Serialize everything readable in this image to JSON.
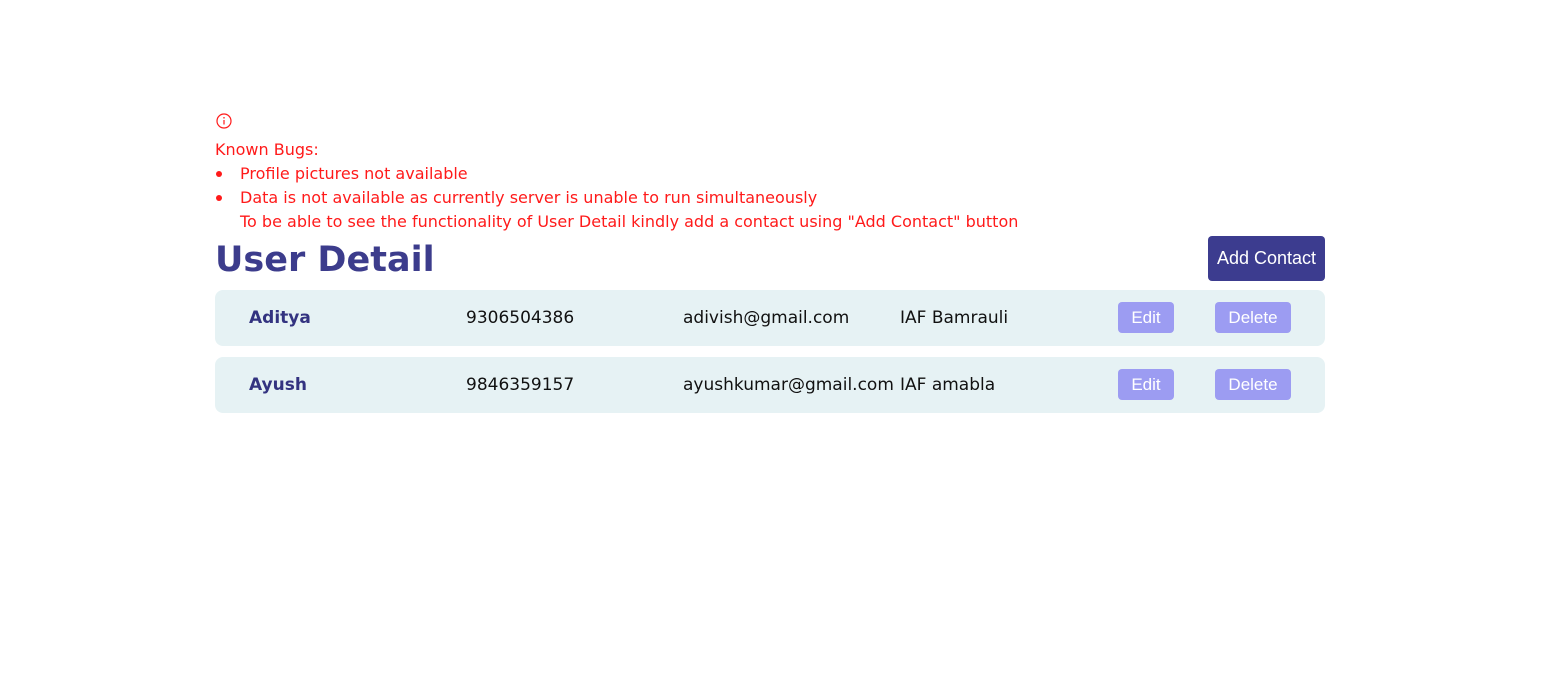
{
  "notice": {
    "icon": "info-circle-icon",
    "title": "Known Bugs:",
    "items": [
      "Profile pictures not available",
      "Data is not available as currently server is unable to run simultaneously"
    ],
    "note": "To be able to see the functionality of User Detail kindly add a contact using \"Add Contact\" button",
    "color": "#ff1a1a"
  },
  "header": {
    "title": "User Detail",
    "add_label": "Add Contact"
  },
  "contacts": [
    {
      "name": "Aditya",
      "phone": "9306504386",
      "email": "adivish@gmail.com",
      "address": "IAF Bamrauli",
      "edit_label": "Edit",
      "delete_label": "Delete"
    },
    {
      "name": "Ayush",
      "phone": "9846359157",
      "email": "ayushkumar@gmail.com",
      "address": "IAF amabla",
      "edit_label": "Edit",
      "delete_label": "Delete"
    }
  ],
  "colors": {
    "accent": "#3c3c8f",
    "row_bg": "#e6f2f4",
    "action_button": "#9c9cf2"
  }
}
